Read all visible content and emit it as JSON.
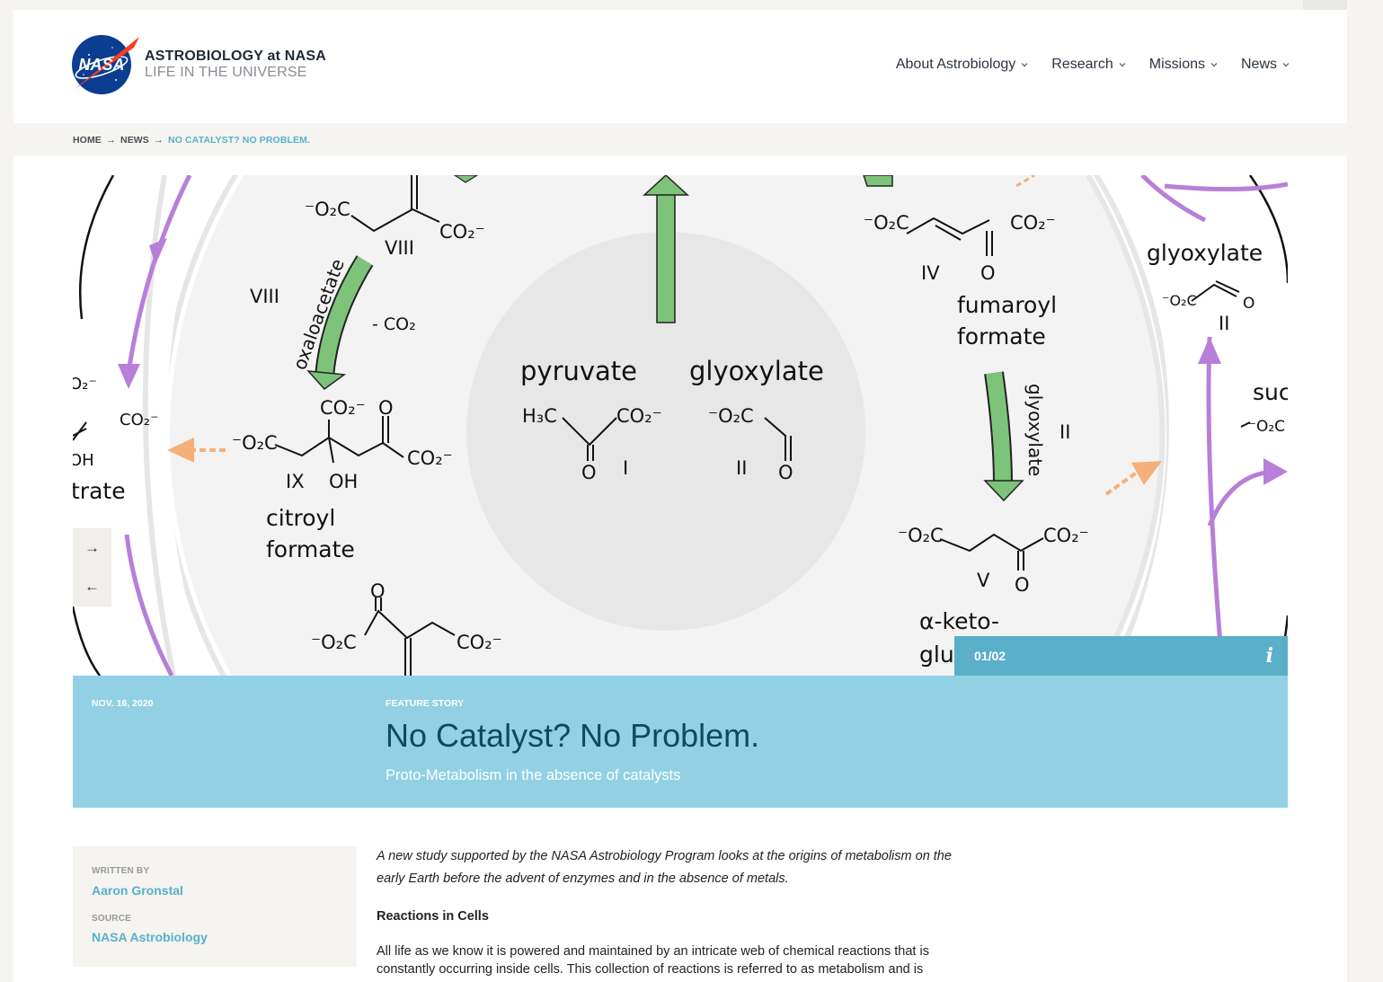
{
  "brand": {
    "logo_icon": "nasa-meatball-icon",
    "logo_text": "NASA",
    "line1": "ASTROBIOLOGY at NASA",
    "line2": "LIFE IN THE UNIVERSE"
  },
  "nav": [
    {
      "label": "About Astrobiology"
    },
    {
      "label": "Research"
    },
    {
      "label": "Missions"
    },
    {
      "label": "News"
    }
  ],
  "breadcrumb": {
    "home": "HOME",
    "news": "NEWS",
    "current": "NO CATALYST? NO PROBLEM."
  },
  "slider": {
    "counter": "01/02",
    "info_icon": "info-icon",
    "next_icon": "arrow-right-icon",
    "prev_icon": "arrow-left-icon",
    "next_glyph": "→",
    "prev_glyph": "←",
    "info_glyph": "i"
  },
  "diagram": {
    "labels": {
      "pyruvate": "pyruvate",
      "glyoxylate_center": "glyoxylate",
      "glyoxylate_right": "glyoxylate",
      "fumaroyl_1": "fumaroyl",
      "fumaroyl_2": "formate",
      "citroyl_1": "citroyl",
      "citroyl_2": "formate",
      "oxaloacetate": "oxaloacetate",
      "glyoxylate_arrow": "glyoxylate",
      "trate": "trate",
      "aketo_1": "α-keto-",
      "aketo_2": "glu",
      "suc": "suc",
      "roman_i": "I",
      "roman_ii": "II",
      "roman_iv": "IV",
      "roman_v": "V",
      "roman_viii": "VIII",
      "roman_ix": "IX",
      "minus_co2": "- CO₂",
      "oh": "OH",
      "o": "O",
      "h3c": "H₃C",
      "co2": "CO₂⁻",
      "o2c": "⁻O₂C"
    },
    "colors": {
      "green": "#7dc47a",
      "purple": "#b87fd9",
      "orange": "#f5b07a",
      "center": "#e8e8e8",
      "ring": "#f2f2f2"
    }
  },
  "article": {
    "date": "NOV. 16, 2020",
    "kicker": "FEATURE STORY",
    "title": "No Catalyst? No Problem.",
    "subtitle": "Proto-Metabolism in the absence of catalysts",
    "meta": {
      "written_by_label": "WRITTEN BY",
      "author": "Aaron Gronstal",
      "source_label": "SOURCE",
      "source": "NASA Astrobiology"
    },
    "intro": "A new study supported by the NASA Astrobiology Program looks at the origins of metabolism on the early Earth before the advent of enzymes and in the absence of metals.",
    "section_heading": "Reactions in Cells",
    "para1": "All life as we know it is powered and maintained by an intricate web of chemical reactions that is constantly occurring inside cells. This collection of reactions is referred to as metabolism and is"
  }
}
